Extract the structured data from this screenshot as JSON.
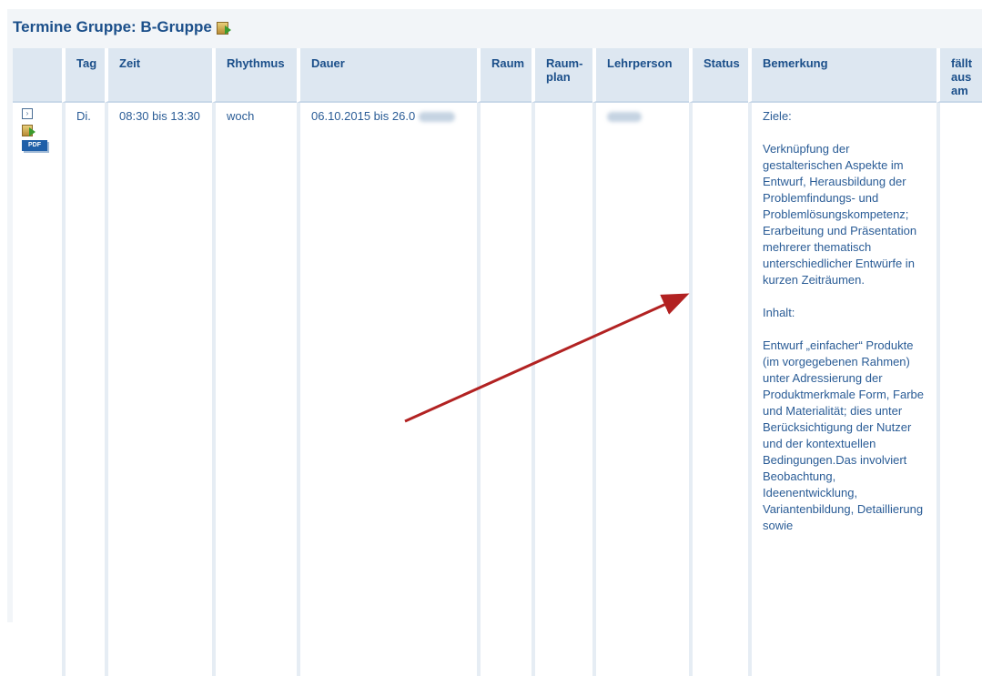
{
  "title": "Termine Gruppe: B-Gruppe",
  "columns": {
    "tag": "Tag",
    "zeit": "Zeit",
    "rhythmus": "Rhythmus",
    "dauer": "Dauer",
    "raum": "Raum",
    "raumplan": "Raum- plan",
    "lehrperson": "Lehrperson",
    "status": "Status",
    "bemerkung": "Bemerkung",
    "faellt": "fällt aus am"
  },
  "row": {
    "tag": "Di.",
    "zeit": "08:30 bis 13:30",
    "rhythmus": "woch",
    "dauer": "06.10.2015 bis 26.0",
    "pdf_label": "PDF",
    "bemerkung": [
      "Ziele:",
      "Verknüpfung der gestalterischen Aspekte im Entwurf, Herausbildung der Problemfindungs- und Problemlösungskompetenz; Erarbeitung und Präsentation mehrerer thematisch unterschiedlicher Entwürfe in kurzen Zeiträumen.",
      "Inhalt:",
      "Entwurf „einfacher“ Produkte (im vorgegebenen Rahmen) unter Adressierung der Produktmerkmale Form, Farbe und Materialität; dies unter Berücksichtigung der Nutzer und der kontextuellen Bedingungen.Das involviert Beobachtung, Ideenentwicklung, Variantenbildung, Detaillierung sowie"
    ]
  },
  "icons": {
    "title_icon": "export-icon",
    "expand_icon": "expand-icon",
    "row_export_icon": "export-icon",
    "pdf_icon": "pdf-icon"
  },
  "colors": {
    "header_bg": "#dde7f1",
    "text": "#1b4f8a",
    "annotation_arrow": "#b22222"
  }
}
